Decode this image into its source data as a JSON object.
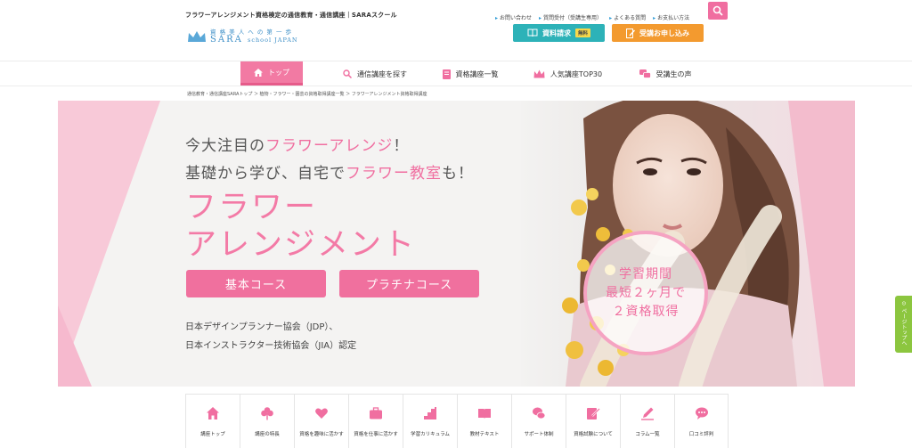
{
  "header": {
    "site_description": "フラワーアレンジメント資格検定の通信教育・通信講座｜SARAスクール",
    "logo_tagline": "資 格 美 人 へ の 第 一 歩",
    "logo_brand": "SARA",
    "logo_brand_sub": "school JAPAN",
    "utility_links": [
      "お問い合わせ",
      "質問受付（受講生専用）",
      "よくある質問",
      "お支払い方法"
    ],
    "cta_brochure": "資料請求",
    "cta_brochure_badge": "無料",
    "cta_apply": "受講お申し込み"
  },
  "nav": {
    "items": [
      "トップ",
      "通信講座を探す",
      "資格講座一覧",
      "人気講座TOP30",
      "受講生の声"
    ]
  },
  "breadcrumb": "通信教育・通信講座SARAトップ ＞ 植物・フラワー・園芸の資格取得講座一覧 ＞ フラワーアレンジメント資格取得講座",
  "hero": {
    "line1_a": "今大注目の",
    "line1_b": "フラワーアレンジ",
    "line1_c": "！",
    "line2_a": "基礎から学び、自宅で",
    "line2_b": "フラワー教室",
    "line2_c": "も！",
    "title1": "フラワー",
    "title2": "アレンジメント",
    "course_basic": "基本コース",
    "course_platinum": "プラチナコース",
    "cert1": "日本デザインプランナー協会（JDP）、",
    "cert2": "日本インストラクター技術協会（JIA）認定",
    "badge1": "学習期間",
    "badge2": "最短２ヶ月で",
    "badge3": "２資格取得"
  },
  "page_top": "ページトップへ",
  "subnav": {
    "items": [
      "講座トップ",
      "講座の特長",
      "資格を趣味に活かす",
      "資格を仕事に活かす",
      "学習カリキュラム",
      "教材テキスト",
      "サポート体制",
      "資格試験について",
      "コラム一覧",
      "口コミ評判"
    ]
  },
  "colors": {
    "accent_pink": "#f06ea0",
    "teal": "#2db2b8",
    "orange": "#f39a2f",
    "logo_blue": "#3d8fc7",
    "page_top_green": "#8cc63f"
  }
}
